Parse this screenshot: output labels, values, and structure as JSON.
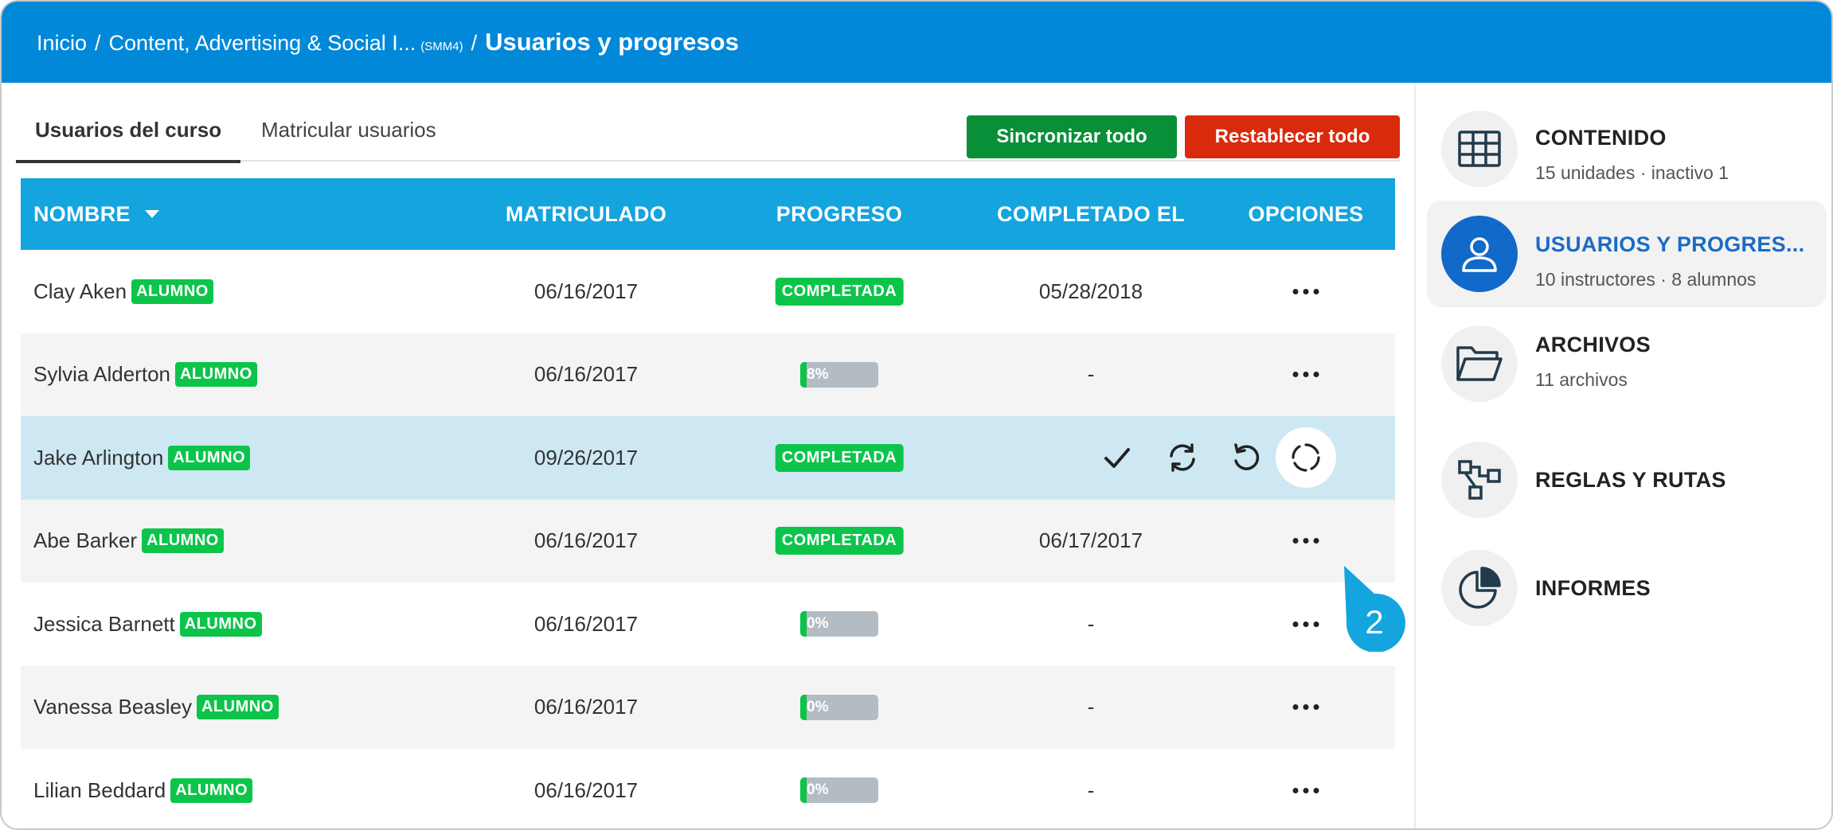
{
  "breadcrumb": {
    "home": "Inicio",
    "course": "Content, Advertising & Social I...",
    "course_code": "(SMM4)",
    "current": "Usuarios y progresos",
    "sep": "/"
  },
  "tabs": [
    {
      "label": "Usuarios del curso",
      "active": true
    },
    {
      "label": "Matricular usuarios",
      "active": false
    }
  ],
  "buttons": {
    "sync_all": "Sincronizar todo",
    "reset_all": "Restablecer todo"
  },
  "colors": {
    "topbar": "#0288d9",
    "header": "#14a4de",
    "green_badge": "#0dc44b",
    "sync": "#088f38",
    "reset": "#d92b0b",
    "active_nav": "#1169c9"
  },
  "table": {
    "columns": {
      "name": "NOMBRE",
      "enrolled": "MATRICULADO",
      "progress": "PROGRESO",
      "completed": "COMPLETADO EL",
      "options": "OPCIONES"
    },
    "sort_icon": "caret-down-icon",
    "rows": [
      {
        "name": "Clay Aken",
        "role": "ALUMNO",
        "enrolled": "06/16/2017",
        "progress_label": "COMPLETADA",
        "progress_pct": 100,
        "completed": "05/28/2018"
      },
      {
        "name": "Sylvia Alderton",
        "role": "ALUMNO",
        "enrolled": "06/16/2017",
        "progress_label": "8%",
        "progress_pct": 8,
        "completed": "-"
      },
      {
        "name": "Jake Arlington",
        "role": "ALUMNO",
        "enrolled": "09/26/2017",
        "progress_label": "COMPLETADA",
        "progress_pct": 100,
        "completed": ""
      },
      {
        "name": "Abe Barker",
        "role": "ALUMNO",
        "enrolled": "06/16/2017",
        "progress_label": "COMPLETADA",
        "progress_pct": 100,
        "completed": "06/17/2017"
      },
      {
        "name": "Jessica Barnett",
        "role": "ALUMNO",
        "enrolled": "06/16/2017",
        "progress_label": "0%",
        "progress_pct": 0,
        "completed": "-"
      },
      {
        "name": "Vanessa Beasley",
        "role": "ALUMNO",
        "enrolled": "06/16/2017",
        "progress_label": "0%",
        "progress_pct": 0,
        "completed": "-"
      },
      {
        "name": "Lilian Beddard",
        "role": "ALUMNO",
        "enrolled": "06/16/2017",
        "progress_label": "0%",
        "progress_pct": 0,
        "completed": "-"
      }
    ]
  },
  "row_actions": [
    "check-icon",
    "sync-icon",
    "undo-icon",
    "reset-progress-icon"
  ],
  "callout": {
    "number": "2"
  },
  "sidebar": {
    "items": [
      {
        "title": "CONTENIDO",
        "subtitle": "15 unidades · inactivo 1",
        "icon": "grid-icon",
        "active": false
      },
      {
        "title": "USUARIOS Y PROGRES...",
        "subtitle": "10 instructores · 8 alumnos",
        "icon": "user-icon",
        "active": true
      },
      {
        "title": "ARCHIVOS",
        "subtitle": "11 archivos",
        "icon": "folder-icon",
        "active": false
      },
      {
        "title": "REGLAS Y RUTAS",
        "subtitle": "",
        "icon": "rules-icon",
        "active": false
      },
      {
        "title": "INFORMES",
        "subtitle": "",
        "icon": "pie-chart-icon",
        "active": false
      }
    ]
  }
}
